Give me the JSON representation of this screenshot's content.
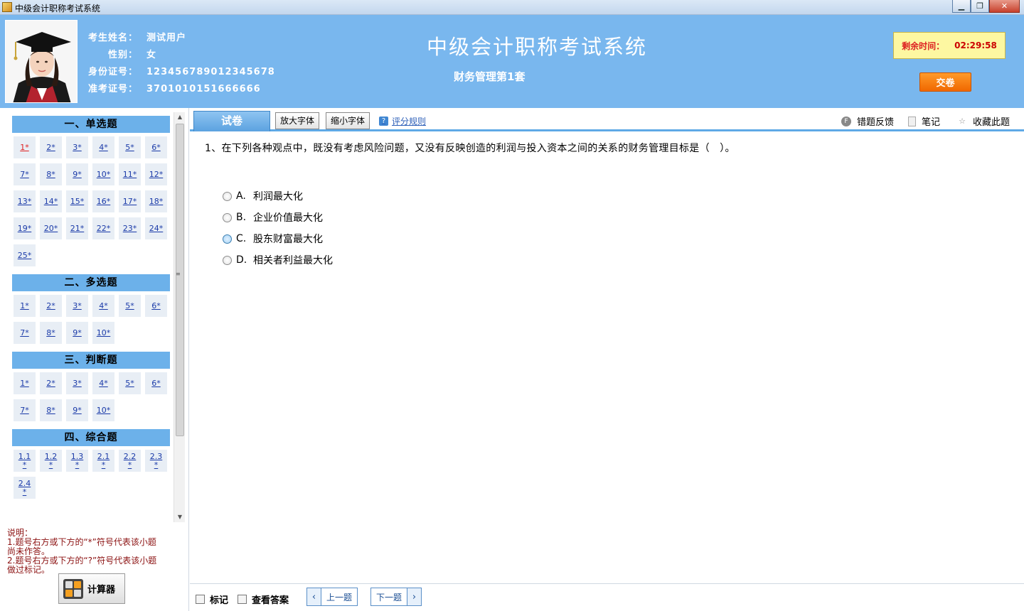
{
  "window": {
    "title": "中级会计职称考试系统",
    "minimize": "▁",
    "maximize": "❐",
    "close": "✕"
  },
  "candidate": {
    "name_label": "考生姓名：",
    "name": "测试用户",
    "gender_label": "性别：",
    "gender": "女",
    "id_label": "身份证号：",
    "id": "123456789012345678",
    "ticket_label": "准考证号：",
    "ticket": "3701010151666666"
  },
  "exam": {
    "title": "中级会计职称考试系统",
    "subtitle": "财务管理第1套"
  },
  "timer": {
    "label": "剩余时间：",
    "value": "02:29:58"
  },
  "submit_label": "交卷",
  "sections": [
    {
      "title": "一、单选题",
      "items": [
        "1*",
        "2*",
        "3*",
        "4*",
        "5*",
        "6*",
        "7*",
        "8*",
        "9*",
        "10*",
        "11*",
        "12*",
        "13*",
        "14*",
        "15*",
        "16*",
        "17*",
        "18*",
        "19*",
        "20*",
        "21*",
        "22*",
        "23*",
        "24*",
        "25*"
      ]
    },
    {
      "title": "二、多选题",
      "items": [
        "1*",
        "2*",
        "3*",
        "4*",
        "5*",
        "6*",
        "7*",
        "8*",
        "9*",
        "10*"
      ]
    },
    {
      "title": "三、判断题",
      "items": [
        "1*",
        "2*",
        "3*",
        "4*",
        "5*",
        "6*",
        "7*",
        "8*",
        "9*",
        "10*"
      ]
    },
    {
      "title": "四、综合题",
      "items": [
        [
          "1.1",
          "*"
        ],
        [
          "1.2",
          "*"
        ],
        [
          "1.3",
          "*"
        ],
        [
          "2.1",
          "*"
        ],
        [
          "2.2",
          "*"
        ],
        [
          "2.3",
          "*"
        ],
        [
          "2.4",
          "*"
        ]
      ]
    }
  ],
  "notes": {
    "line1": "说明：",
    "line2": "1.题号右方或下方的“*”符号代表该小题",
    "line3": "尚未作答。",
    "line4": "2.题号右方或下方的“?”符号代表该小题",
    "line5": "做过标记。"
  },
  "calculator_label": "计算器",
  "toolbar": {
    "tab_paper": "试卷",
    "enlarge_font": "放大字体",
    "shrink_font": "缩小字体",
    "rules": "评分规则",
    "feedback": "错题反馈",
    "notes": "笔记",
    "favorite": "收藏此题"
  },
  "question": {
    "text": "1、在下列各种观点中，既没有考虑风险问题，又没有反映创造的利润与投入资本之间的关系的财务管理目标是（　）。",
    "options": [
      {
        "letter": "A.",
        "text": "利润最大化"
      },
      {
        "letter": "B.",
        "text": "企业价值最大化"
      },
      {
        "letter": "C.",
        "text": "股东财富最大化"
      },
      {
        "letter": "D.",
        "text": "相关者利益最大化"
      }
    ]
  },
  "bottom": {
    "mark": "标记",
    "view_answer": "查看答案",
    "prev": "上一题",
    "next": "下一题"
  }
}
